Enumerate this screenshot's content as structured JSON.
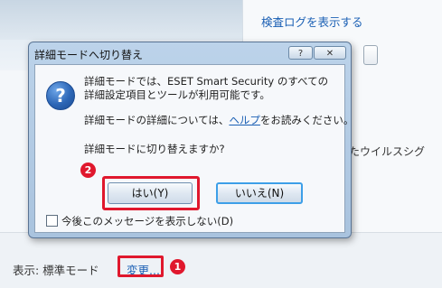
{
  "background": {
    "log_link": "検査ログを表示する",
    "virus_text": "したウイルスシグ",
    "status_label": "表示: 標準モード",
    "change_link": "変更..."
  },
  "dialog": {
    "title": "詳細モードへ切り替え",
    "help_button": "?",
    "close_button": "✕",
    "message_line1": "詳細モードでは、ESET Smart Security のすべての",
    "message_line2": "詳細設定項目とツールが利用可能です。",
    "message_line3_prefix": "詳細モードの詳細については、",
    "help_link": "ヘルプ",
    "message_line3_suffix": "をお読みください。",
    "question": "詳細モードに切り替えますか?",
    "yes_button": "はい(Y)",
    "no_button": "いいえ(N)",
    "dont_show_checkbox": "今後このメッセージを表示しない(D)",
    "dont_show_checked": false
  },
  "annotations": {
    "badge1": "1",
    "badge2": "2",
    "highlight_color": "#e0182d"
  },
  "icons": {
    "question_icon": "?"
  }
}
